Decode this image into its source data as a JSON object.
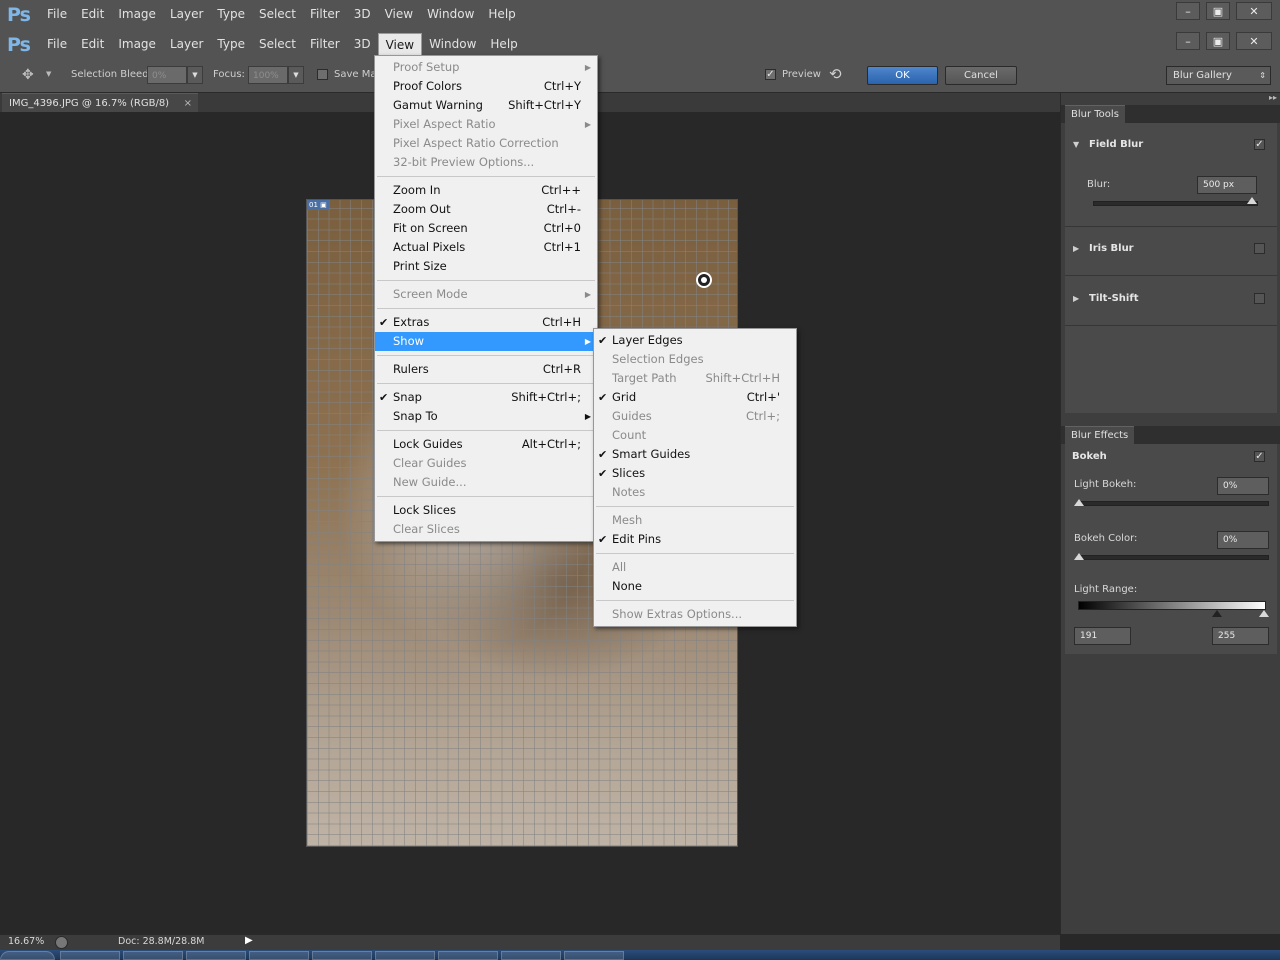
{
  "app": {
    "logo": "Ps"
  },
  "menubar": [
    "File",
    "Edit",
    "Image",
    "Layer",
    "Type",
    "Select",
    "Filter",
    "3D",
    "View",
    "Window",
    "Help"
  ],
  "window_controls": {
    "minimize": "–",
    "restore": "▣",
    "close": "✕"
  },
  "options_bar": {
    "selection_bleed_label": "Selection Bleed:",
    "selection_bleed_value": "0%",
    "focus_label": "Focus:",
    "focus_value": "100%",
    "save_mask_label": "Save Ma",
    "preview_label": "Preview",
    "preview_checked": true,
    "ok_label": "OK",
    "cancel_label": "Cancel",
    "workspace_select": "Blur Gallery"
  },
  "document_tab": {
    "title": "IMG_4396.JPG @ 16.7% (RGB/8)",
    "close": "×"
  },
  "canvas": {
    "slice_badge": "01"
  },
  "view_menu": [
    {
      "label": "Proof Setup",
      "shortcut": "",
      "submenu": true,
      "disabled": true
    },
    {
      "label": "Proof Colors",
      "shortcut": "Ctrl+Y"
    },
    {
      "label": "Gamut Warning",
      "shortcut": "Shift+Ctrl+Y"
    },
    {
      "label": "Pixel Aspect Ratio",
      "shortcut": "",
      "submenu": true,
      "disabled": true
    },
    {
      "label": "Pixel Aspect Ratio Correction",
      "shortcut": "",
      "disabled": true
    },
    {
      "label": "32-bit Preview Options...",
      "shortcut": "",
      "disabled": true
    },
    {
      "sep": true
    },
    {
      "label": "Zoom In",
      "shortcut": "Ctrl++"
    },
    {
      "label": "Zoom Out",
      "shortcut": "Ctrl+-"
    },
    {
      "label": "Fit on Screen",
      "shortcut": "Ctrl+0"
    },
    {
      "label": "Actual Pixels",
      "shortcut": "Ctrl+1"
    },
    {
      "label": "Print Size",
      "shortcut": ""
    },
    {
      "sep": true
    },
    {
      "label": "Screen Mode",
      "shortcut": "",
      "submenu": true,
      "disabled": true
    },
    {
      "sep": true
    },
    {
      "label": "Extras",
      "shortcut": "Ctrl+H",
      "checked": true
    },
    {
      "label": "Show",
      "shortcut": "",
      "submenu": true,
      "highlighted": true
    },
    {
      "sep": true
    },
    {
      "label": "Rulers",
      "shortcut": "Ctrl+R"
    },
    {
      "sep": true
    },
    {
      "label": "Snap",
      "shortcut": "Shift+Ctrl+;",
      "checked": true
    },
    {
      "label": "Snap To",
      "shortcut": "",
      "submenu": true
    },
    {
      "sep": true
    },
    {
      "label": "Lock Guides",
      "shortcut": "Alt+Ctrl+;"
    },
    {
      "label": "Clear Guides",
      "shortcut": "",
      "disabled": true
    },
    {
      "label": "New Guide...",
      "shortcut": "",
      "disabled": true
    },
    {
      "sep": true
    },
    {
      "label": "Lock Slices",
      "shortcut": ""
    },
    {
      "label": "Clear Slices",
      "shortcut": "",
      "disabled": true
    }
  ],
  "show_submenu": [
    {
      "label": "Layer Edges",
      "shortcut": "",
      "checked": true
    },
    {
      "label": "Selection Edges",
      "shortcut": "",
      "disabled": true
    },
    {
      "label": "Target Path",
      "shortcut": "Shift+Ctrl+H",
      "disabled": true
    },
    {
      "label": "Grid",
      "shortcut": "Ctrl+'",
      "checked": true
    },
    {
      "label": "Guides",
      "shortcut": "Ctrl+;",
      "disabled": true
    },
    {
      "label": "Count",
      "shortcut": "",
      "disabled": true
    },
    {
      "label": "Smart Guides",
      "shortcut": "",
      "checked": true
    },
    {
      "label": "Slices",
      "shortcut": "",
      "checked": true
    },
    {
      "label": "Notes",
      "shortcut": "",
      "disabled": true
    },
    {
      "sep": true
    },
    {
      "label": "Mesh",
      "shortcut": "",
      "disabled": true
    },
    {
      "label": "Edit Pins",
      "shortcut": "",
      "checked": true
    },
    {
      "sep": true
    },
    {
      "label": "All",
      "shortcut": "",
      "disabled": true
    },
    {
      "label": "None",
      "shortcut": ""
    },
    {
      "sep": true
    },
    {
      "label": "Show Extras Options...",
      "shortcut": "",
      "disabled": true
    }
  ],
  "blur_tools": {
    "tab": "Blur Tools",
    "field_blur": {
      "title": "Field Blur",
      "checked": true,
      "blur_label": "Blur:",
      "blur_value": "500 px"
    },
    "iris_blur": {
      "title": "Iris Blur",
      "checked": false
    },
    "tilt_shift": {
      "title": "Tilt-Shift",
      "checked": false
    }
  },
  "blur_effects": {
    "tab": "Blur Effects",
    "bokeh": {
      "title": "Bokeh",
      "checked": true
    },
    "light_bokeh": {
      "label": "Light Bokeh:",
      "value": "0%"
    },
    "bokeh_color": {
      "label": "Bokeh Color:",
      "value": "0%"
    },
    "light_range": {
      "label": "Light Range:",
      "low": "191",
      "high": "255"
    }
  },
  "status": {
    "zoom": "16.67%",
    "doc": "Doc: 28.8M/28.8M"
  }
}
